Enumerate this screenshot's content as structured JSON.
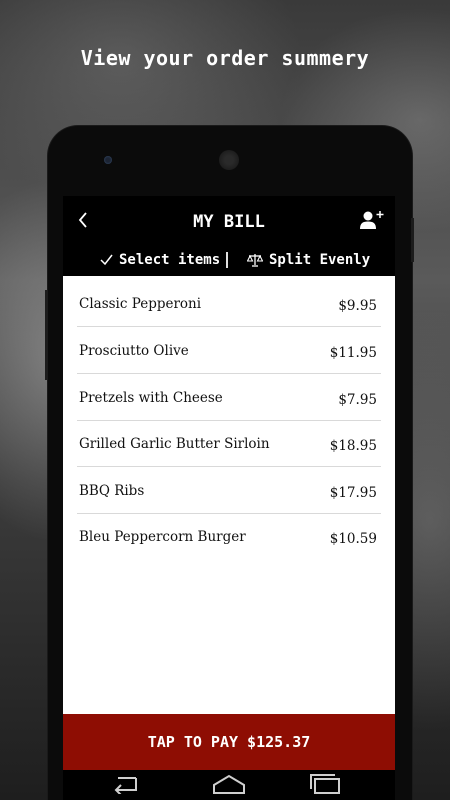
{
  "headline": "View your order summery",
  "appbar": {
    "title": "MY BILL",
    "back_icon": "chevron-left-icon",
    "add_user_icon": "add-user-icon"
  },
  "tabs": {
    "select_items": "Select items",
    "split_evenly": "Split Evenly"
  },
  "bill": {
    "items": [
      {
        "name": "Classic Pepperoni",
        "price": "$9.95"
      },
      {
        "name": "Prosciutto Olive",
        "price": "$11.95"
      },
      {
        "name": "Pretzels with Cheese",
        "price": "$7.95"
      },
      {
        "name": "Grilled Garlic Butter Sirloin",
        "price": "$18.95"
      },
      {
        "name": "BBQ Ribs",
        "price": "$17.95"
      },
      {
        "name": "Bleu Peppercorn Burger",
        "price": "$10.59"
      }
    ]
  },
  "pay": {
    "label": "TAP TO PAY $125.37"
  },
  "colors": {
    "pay_bar": "#8e0d03",
    "screen_bg": "#000000",
    "list_bg": "#ffffff"
  },
  "navbar": {
    "back_icon": "nav-back-icon",
    "home_icon": "nav-home-icon",
    "recents_icon": "nav-recents-icon"
  }
}
